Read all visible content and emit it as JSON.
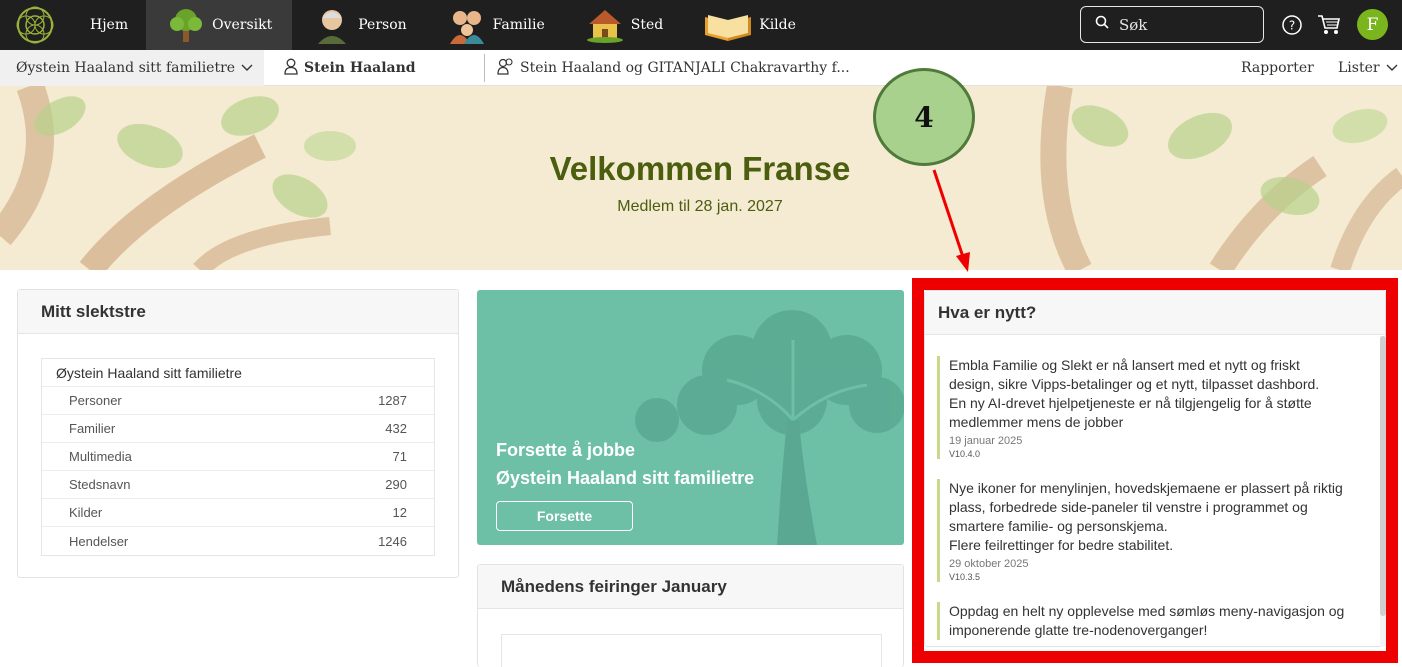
{
  "nav": {
    "items": [
      {
        "label": "Hjem",
        "icon": "home-icon"
      },
      {
        "label": "Oversikt",
        "icon": "tree-icon"
      },
      {
        "label": "Person",
        "icon": "person-icon"
      },
      {
        "label": "Familie",
        "icon": "family-icon"
      },
      {
        "label": "Sted",
        "icon": "house-icon"
      },
      {
        "label": "Kilde",
        "icon": "book-icon"
      }
    ],
    "search_placeholder": "Søk",
    "avatar_initial": "F"
  },
  "subbar": {
    "tree": "Øystein Haaland sitt familietre",
    "person": "Stein Haaland",
    "family": "Stein Haaland og GITANJALI Chakravarthy f...",
    "reports": "Rapporter",
    "lists": "Lister"
  },
  "hero": {
    "title": "Velkommen Franse",
    "subtitle": "Medlem til 28 jan. 2027"
  },
  "callout": {
    "number": "4"
  },
  "my_tree": {
    "title": "Mitt slektstre",
    "tree_name": "Øystein Haaland sitt familietre",
    "rows": [
      {
        "label": "Personer",
        "value": "1287"
      },
      {
        "label": "Familier",
        "value": "432"
      },
      {
        "label": "Multimedia",
        "value": "71"
      },
      {
        "label": "Stedsnavn",
        "value": "290"
      },
      {
        "label": "Kilder",
        "value": "12"
      },
      {
        "label": "Hendelser",
        "value": "1246"
      }
    ]
  },
  "continue_card": {
    "line1": "Forsette å jobbe",
    "line2": "Øystein Haaland sitt familietre",
    "button": "Forsette"
  },
  "celebrations": {
    "title": "Månedens feiringer January"
  },
  "news": {
    "title": "Hva er nytt?",
    "items": [
      {
        "lines": [
          "Embla Familie og Slekt er nå lansert med et nytt og friskt design, sikre Vipps-betalinger og et nytt, tilpasset dashbord.",
          "En ny AI-drevet hjelpetjeneste er nå tilgjengelig for å støtte medlemmer mens de jobber"
        ],
        "date": "19 januar 2025",
        "version": "V10.4.0"
      },
      {
        "lines": [
          "Nye ikoner for menylinjen, hovedskjemaene er plassert på riktig plass, forbedrede side-paneler til venstre i programmet og smartere familie- og personskjema.",
          "Flere feilrettinger for bedre stabilitet."
        ],
        "date": "29 oktober 2025",
        "version": "V10.3.5"
      },
      {
        "lines": [
          "Oppdag en helt ny opplevelse med sømløs meny-navigasjon og imponerende glatte tre-nodenoverganger!"
        ],
        "date": "",
        "version": ""
      }
    ]
  },
  "colors": {
    "topbar": "#1f1f1f",
    "accent_green": "#7ab51d",
    "hero_text": "#4a5e0e",
    "teal_card": "#6dbfa6",
    "highlight_red": "#ee0000"
  }
}
